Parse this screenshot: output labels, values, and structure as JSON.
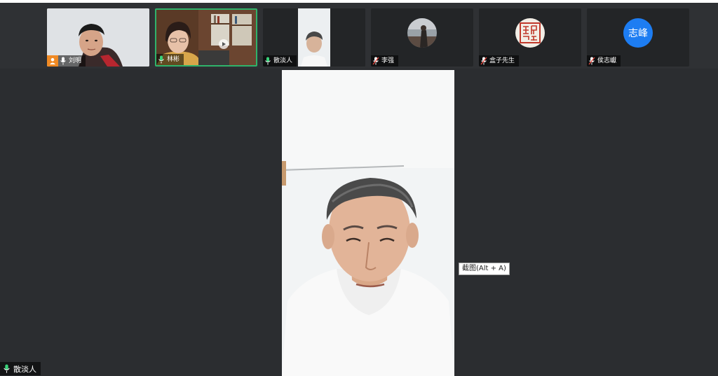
{
  "participants": [
    {
      "name": "刘明",
      "host": true,
      "muted": false,
      "active": false,
      "video": true
    },
    {
      "name": "林彬",
      "host": false,
      "muted": false,
      "active": true,
      "video": true
    },
    {
      "name": "散淡人",
      "host": false,
      "muted": false,
      "active": false,
      "video": true
    },
    {
      "name": "李强",
      "host": false,
      "muted": true,
      "active": false,
      "video": false,
      "avatar": "photo"
    },
    {
      "name": "盒子先生",
      "host": false,
      "muted": true,
      "active": false,
      "video": false,
      "avatar": "seal"
    },
    {
      "name": "侯志巘",
      "host": false,
      "muted": true,
      "active": false,
      "video": false,
      "avatar_text": "志峰"
    }
  ],
  "main_speaker": {
    "name": "散淡人"
  },
  "tooltip": {
    "text": "截图(Alt + A)"
  },
  "colors": {
    "background": "#2b2d30",
    "active_border": "#2fb36b",
    "host_badge": "#f08a24",
    "avatar_blue": "#1d7df2"
  }
}
